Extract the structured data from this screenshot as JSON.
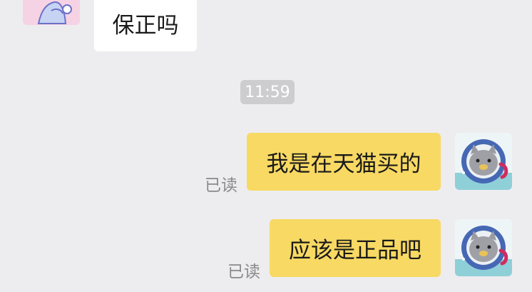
{
  "messages": [
    {
      "text": "保正吗"
    },
    {
      "text": "我是在天猫买的",
      "status": "已读"
    },
    {
      "text": "应该是正品吧",
      "status": "已读"
    }
  ],
  "timestamp": "11:59",
  "colors": {
    "background": "#ededef",
    "incoming_bubble": "#ffffff",
    "outgoing_bubble": "#f8d963",
    "timestamp_bg": "#cdcdcf"
  },
  "icons": [
    "contact-avatar-icon",
    "my-avatar-cat-icon"
  ]
}
